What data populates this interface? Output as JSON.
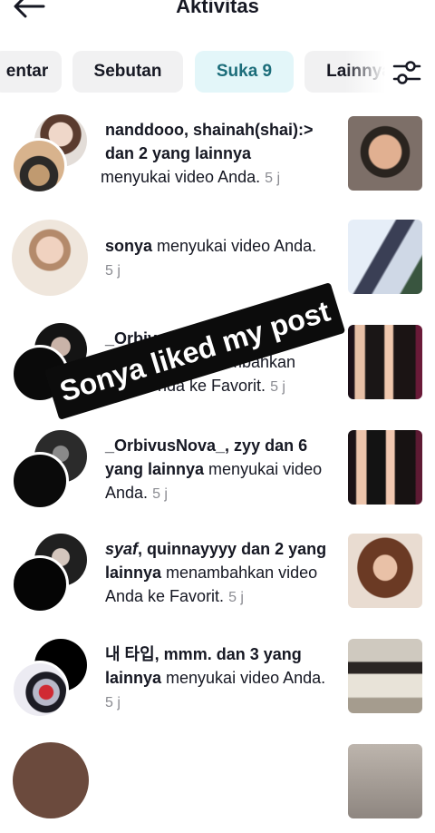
{
  "header": {
    "title": "Aktivitas"
  },
  "tabs": [
    {
      "label": "entar"
    },
    {
      "label": "Sebutan"
    },
    {
      "label": "Suka 9"
    },
    {
      "label": "Lainnya"
    }
  ],
  "items": [
    {
      "bold1": "nanddooo, shainah(shai):>",
      "bold2": "dan 2 yang lainnya",
      "rest": " menyukai video Anda.",
      "time": "5 j"
    },
    {
      "bold1": "sonya",
      "rest": " menyukai video Anda.",
      "time": "5 j"
    },
    {
      "part1": "_Orbiv",
      "part2": "nambahkan",
      "part3": "nda ke Favorit.",
      "time": "5 j"
    },
    {
      "bold1": "_OrbivusNova_, zyy dan 6",
      "bold2": "yang lainnya",
      "rest": " menyukai video Anda.",
      "time": "5 j"
    },
    {
      "italic": "syaf",
      "bold1": ", quinnayyyy dan 2 yang",
      "bold2": "lainnya",
      "rest": " menambahkan video Anda ke Favorit.",
      "time": "5 j"
    },
    {
      "bold1": "내 타입, mmm. dan 3 yang",
      "bold2": "lainnya",
      "rest": " menyukai video Anda.",
      "time": "5 j"
    }
  ],
  "sticker": {
    "text": "Sonya liked my post"
  }
}
